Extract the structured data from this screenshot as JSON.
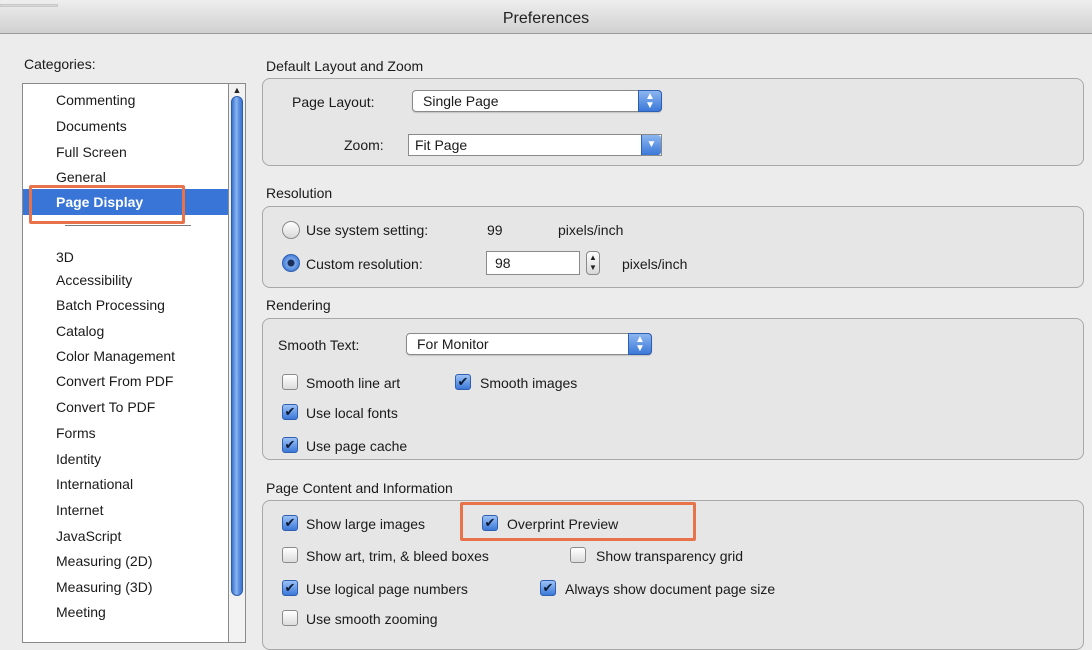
{
  "window": {
    "title": "Preferences"
  },
  "categories": {
    "label": "Categories:",
    "items": [
      "Commenting",
      "Documents",
      "Full Screen",
      "General",
      "Page Display",
      "3D",
      "Accessibility",
      "Batch Processing",
      "Catalog",
      "Color Management",
      "Convert From PDF",
      "Convert To PDF",
      "Forms",
      "Identity",
      "International",
      "Internet",
      "JavaScript",
      "Measuring (2D)",
      "Measuring (3D)",
      "Meeting"
    ],
    "selected": "Page Display"
  },
  "layout_zoom": {
    "heading": "Default Layout and Zoom",
    "page_layout_label": "Page Layout:",
    "page_layout_value": "Single Page",
    "zoom_label": "Zoom:",
    "zoom_value": "Fit Page"
  },
  "resolution": {
    "heading": "Resolution",
    "system_label": "Use system setting:",
    "system_value": "99",
    "system_unit": "pixels/inch",
    "custom_label": "Custom resolution:",
    "custom_value": "98",
    "custom_unit": "pixels/inch",
    "selected": "custom"
  },
  "rendering": {
    "heading": "Rendering",
    "smooth_text_label": "Smooth Text:",
    "smooth_text_value": "For Monitor",
    "smooth_line_art": {
      "label": "Smooth line art",
      "checked": false
    },
    "smooth_images": {
      "label": "Smooth images",
      "checked": true
    },
    "use_local_fonts": {
      "label": "Use local fonts",
      "checked": true
    },
    "use_page_cache": {
      "label": "Use page cache",
      "checked": true
    }
  },
  "page_content": {
    "heading": "Page Content and Information",
    "show_large_images": {
      "label": "Show large images",
      "checked": true
    },
    "overprint_preview": {
      "label": "Overprint Preview",
      "checked": true
    },
    "show_art_trim_bleed": {
      "label": "Show art, trim, & bleed boxes",
      "checked": false
    },
    "show_transparency_grid": {
      "label": "Show transparency grid",
      "checked": false
    },
    "use_logical_page_numbers": {
      "label": "Use logical page numbers",
      "checked": true
    },
    "always_show_page_size": {
      "label": "Always show document page size",
      "checked": true
    },
    "use_smooth_zooming": {
      "label": "Use smooth zooming",
      "checked": false
    }
  },
  "colors": {
    "selection": "#3875d7",
    "highlight": "#e8734a"
  }
}
